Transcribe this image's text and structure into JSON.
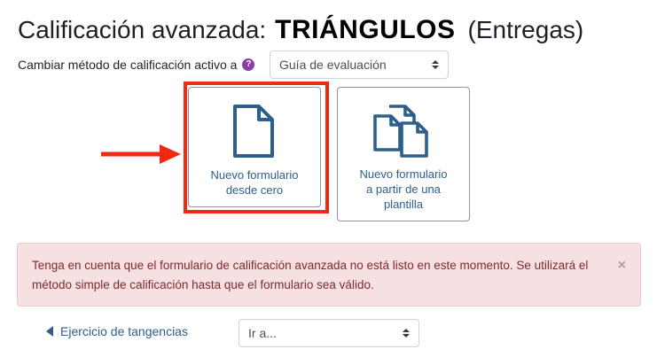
{
  "heading": {
    "title_prefix": "Calificación avanzada:",
    "activity_name": "TRIÁNGULOS",
    "suffix": "(Entregas)"
  },
  "method": {
    "label": "Cambiar método de calificación activo a",
    "help_icon": "help-question-icon",
    "help_symbol": "?",
    "selected": "Guía de evaluación"
  },
  "cards": {
    "new_from_scratch": {
      "icon": "document-icon",
      "line1": "Nuevo formulario",
      "line2": "desde cero"
    },
    "new_from_template": {
      "icon": "documents-copy-icon",
      "line1": "Nuevo formulario",
      "line2": "a partir de una",
      "line3": "plantilla"
    }
  },
  "alert": {
    "message": "Tenga en cuenta que el formulario de calificación avanzada no está listo en este momento. Se utilizará el método simple de calificación hasta que el formulario sea válido.",
    "close_symbol": "×"
  },
  "navigation": {
    "previous_activity": "Ejercicio de tangencias",
    "jump_to": "Ir a..."
  },
  "colors": {
    "annotation_red": "#ef2a12",
    "link_blue": "#2c5f8d",
    "alert_bg": "#f6e0e1",
    "alert_text": "#7d2a2e",
    "help_purple": "#8b3ea8"
  }
}
